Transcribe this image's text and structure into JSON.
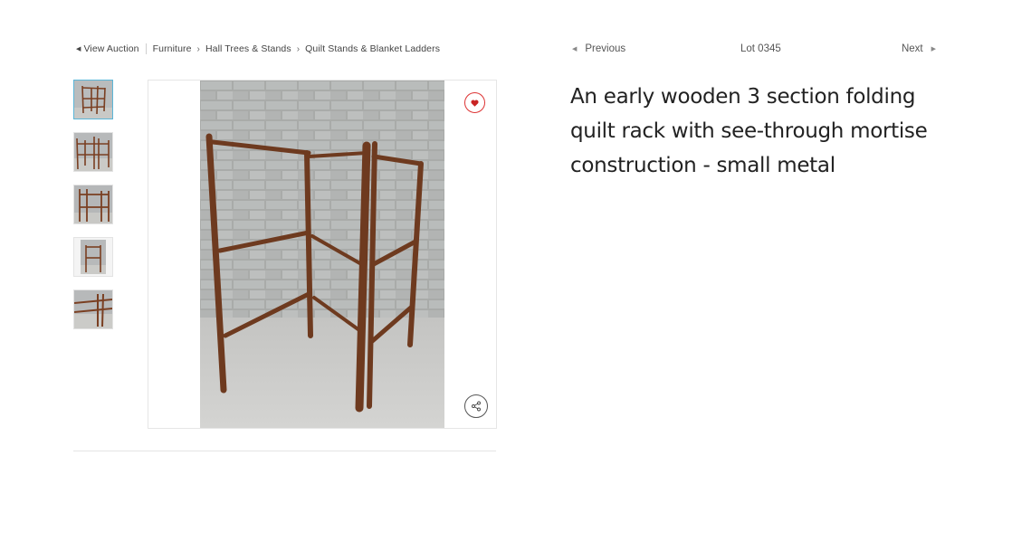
{
  "breadcrumb": {
    "back_label": "View Auction",
    "items": [
      "Furniture",
      "Hall Trees & Stands",
      "Quilt Stands & Blanket Ladders"
    ]
  },
  "lot_nav": {
    "previous_label": "Previous",
    "lot_label": "Lot 0345",
    "next_label": "Next"
  },
  "lot": {
    "title": "An early wooden 3 section folding quilt rack with see-through mortise construction - small metal"
  },
  "gallery": {
    "thumbnail_count": 5,
    "active_index": 0
  },
  "colors": {
    "accent": "#5bb6d8",
    "favorite": "#d33333",
    "wood": "#7a3f22"
  },
  "icons": {
    "favorite": "heart-icon",
    "share": "share-icon",
    "back": "caret-left-icon",
    "previous": "triangle-left-icon",
    "next": "triangle-right-icon",
    "separator": "chevron-right-icon"
  }
}
